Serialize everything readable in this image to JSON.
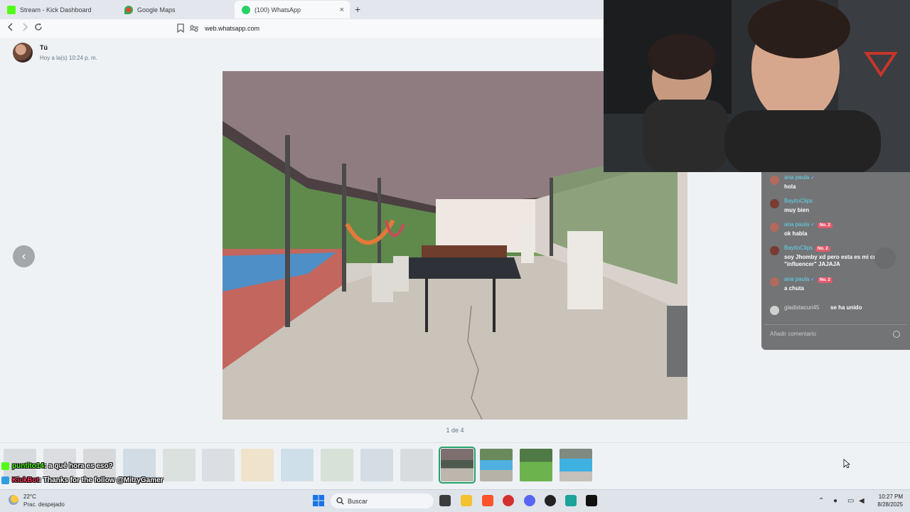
{
  "browser": {
    "tabs": [
      {
        "label": "Stream - Kick Dashboard",
        "icon": "kick-icon"
      },
      {
        "label": "Google Maps",
        "icon": "maps-pin-icon"
      },
      {
        "label": "(100) WhatsApp",
        "icon": "whatsapp-icon",
        "active": true
      }
    ],
    "new_tab": "+",
    "close_tab": "×",
    "url": "web.whatsapp.com"
  },
  "viewer": {
    "sender": "Tú",
    "sent_time": "Hoy a la(s) 10:24 p. m.",
    "counter": "1 de 4",
    "prev_glyph": "‹"
  },
  "stream_chat": {
    "messages": [
      {
        "user": "ana paula",
        "verified": true,
        "text": "hola"
      },
      {
        "user": "BayitoClips",
        "text": "muy bien"
      },
      {
        "user": "ana paula",
        "verified": true,
        "badge": "No. 2",
        "text": "ok habla"
      },
      {
        "user": "BayitoClips",
        "badge": "No. 2",
        "text": "soy Jhomby xd pero esta es mi cuenta \"influencer\" JAJAJA"
      },
      {
        "user": "ana paula",
        "verified": true,
        "badge": "No. 2",
        "text": "a chuta"
      }
    ],
    "join_user": "gladistacuri45",
    "join_text": "se ha unido",
    "input_placeholder": "Añadir comentario"
  },
  "overlay": {
    "line1_user": "puntito14",
    "line1_text": ": a qué hora es eso?",
    "line2_user": "KickBot",
    "line2_text": ": Thanks for the follow @MitryGamer"
  },
  "taskbar": {
    "temp": "22°C",
    "weather": "Prac. despejado",
    "search_placeholder": "Buscar",
    "time": "10:27 PM",
    "date": "8/28/2025"
  },
  "colors": {
    "whatsapp_green": "#25a26a",
    "kick_green": "#53fc18",
    "chat_username": "#62d7f0",
    "badge": "#e35a6c"
  }
}
